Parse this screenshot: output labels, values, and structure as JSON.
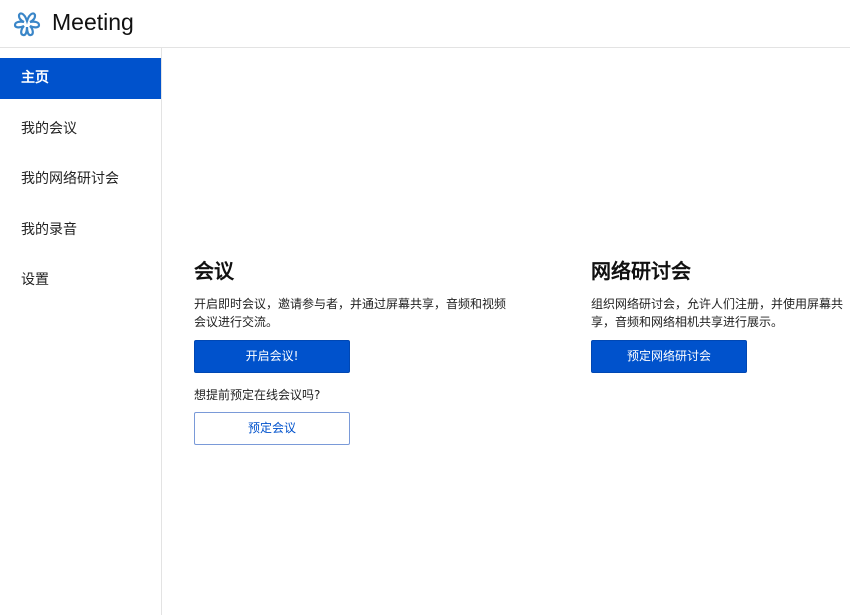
{
  "header": {
    "brand": "Meeting",
    "logo_icon": "flower-logo-icon"
  },
  "sidebar": {
    "items": [
      {
        "label": "主页",
        "active": true
      },
      {
        "label": "我的会议"
      },
      {
        "label": "我的网络研讨会"
      },
      {
        "label": "我的录音"
      },
      {
        "label": "设置"
      }
    ]
  },
  "meeting": {
    "title": "会议",
    "desc_line1": "开启即时会议，邀请参与者，并通过屏幕共享，音频和视频",
    "desc_line2": "会议进行交流。",
    "start_button": "开启会议!",
    "question": "想提前预定在线会议吗?",
    "schedule_button": "预定会议"
  },
  "webinar": {
    "title": "网络研讨会",
    "desc_line1": "组织网络研讨会，允许人们注册，并使用屏幕共",
    "desc_line2": "享，音频和网络相机共享进行展示。",
    "schedule_button": "预定网络研讨会"
  },
  "colors": {
    "accent": "#0052cc"
  }
}
